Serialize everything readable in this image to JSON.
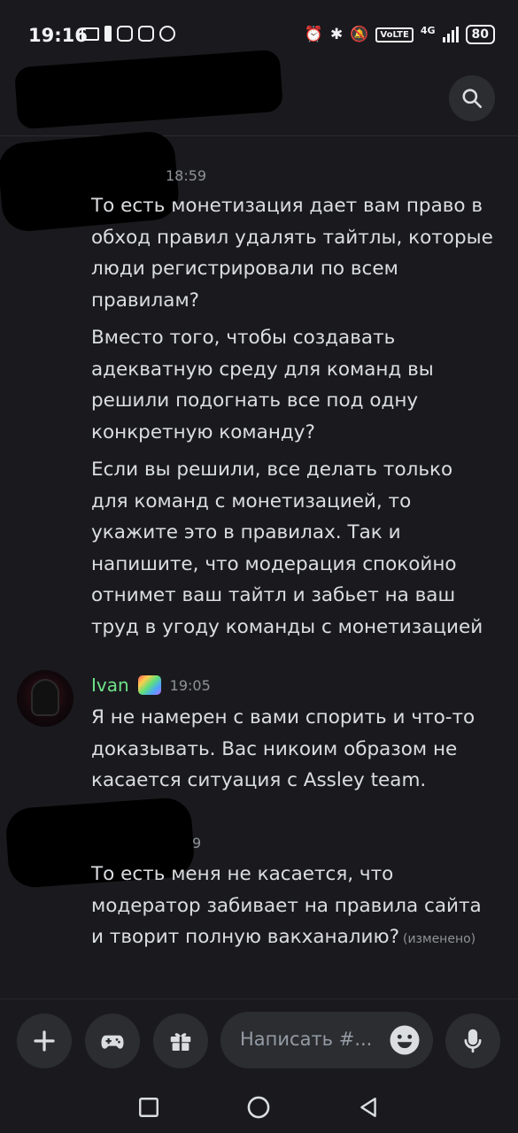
{
  "status_bar": {
    "time": "19:16",
    "icons_left": [
      "mail-icon",
      "battery-saver-icon",
      "instagram-icon",
      "instagram-icon",
      "keyhole-icon"
    ],
    "icons_right": [
      "alarm-icon",
      "bluetooth-icon",
      "mute-icon",
      "volte-icon",
      "4g-signal-icon"
    ],
    "volte": "VoLTE",
    "network": "4G",
    "battery": "80"
  },
  "header": {
    "search_icon": "search-icon"
  },
  "messages": [
    {
      "author": "",
      "time": "18:59",
      "paragraphs": [
        "То есть монетизация дает вам право в обход правил удалять тайтлы, которые люди регистрировали по всем правилам?",
        "Вместо того, чтобы создавать адекватную среду для команд вы решили подогнать все под одну конкретную команду?",
        "Если вы решили, все делать только для команд с монетизацией, то укажите это в правилах. Так и напишите, что модерация спокойно отнимет ваш тайтл и забьет на ваш труд в угоду команды с монетизацией"
      ]
    },
    {
      "author": "Ivan",
      "time": "19:05",
      "paragraphs": [
        "Я не намерен с вами спорить и что-то доказывать. Вас никоим образом не касается ситуация с Assley team."
      ]
    },
    {
      "author": "",
      "time": "9",
      "paragraphs": [
        "То есть меня не касается, что модератор забивает на правила сайта и творит полную вакханалию?"
      ],
      "edited": "(изменено)"
    }
  ],
  "composer": {
    "placeholder": "Написать #...",
    "buttons": [
      "plus-icon",
      "gamepad-icon",
      "gift-icon",
      "emoji-icon",
      "microphone-icon"
    ]
  },
  "nav": [
    "recents-square-icon",
    "home-circle-icon",
    "back-triangle-icon"
  ],
  "colors": {
    "background": "#1a1a1e",
    "text": "#dbdee1",
    "muted": "#8e9297",
    "author_green": "#6fe38a",
    "button_bg": "#2b2d31"
  }
}
